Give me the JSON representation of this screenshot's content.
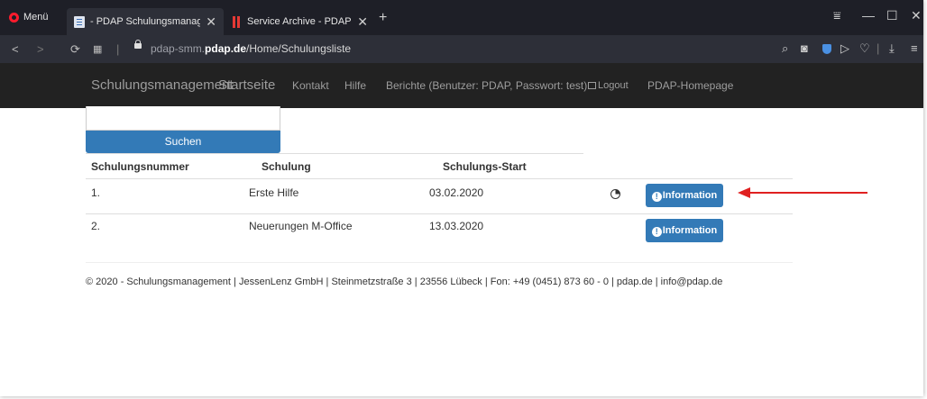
{
  "browser": {
    "menu_label": "Menü",
    "tabs": [
      {
        "title": "- PDAP Schulungsmanagem",
        "close": "✕"
      },
      {
        "title": "Service Archive - PDAP by J",
        "close": "✕"
      }
    ],
    "new_tab": "+",
    "window_controls": {
      "filter": "⩸",
      "minimize": "—",
      "maximize": "☐",
      "close": "✕"
    },
    "address": {
      "url_prefix": "pdap-smm.",
      "url_domain": "pdap.de",
      "url_path": "/Home/Schulungsliste"
    },
    "icons": [
      "back-icon",
      "forward-icon",
      "reload-icon",
      "speed-dial-icon",
      "lock-icon",
      "search-icon",
      "snapshot-icon",
      "shield-icon",
      "send-icon",
      "heart-icon",
      "download-icon",
      "easy-setup-icon"
    ],
    "accent_color": "#ff1b2d"
  },
  "navbar": {
    "brand": "Schulungsmanagement",
    "items": [
      "Startseite",
      "Kontakt",
      "Hilfe",
      "Berichte (Benutzer: PDAP, Passwort: test)",
      "Logout",
      "PDAP-Homepage"
    ]
  },
  "search": {
    "button_label": "Suchen",
    "value": ""
  },
  "table": {
    "headers": [
      "Schulungsnummer",
      "Schulung",
      "Schulungs-Start"
    ],
    "rows": [
      {
        "number": "1.",
        "name": "Erste Hilfe",
        "start": "03.02.2020",
        "has_clock": true,
        "button": "Information"
      },
      {
        "number": "2.",
        "name": "Neuerungen M-Office",
        "start": "13.03.2020",
        "has_clock": false,
        "button": "Information"
      }
    ]
  },
  "footer": {
    "text": "© 2020 - Schulungsmanagement | JessenLenz GmbH | Steinmetzstraße 3 | 23556 Lübeck | Fon: +49 (0451) 873 60 - 0 | pdap.de | info@pdap.de"
  },
  "colors": {
    "primary": "#337ab7",
    "navbar": "#222222",
    "annotation_arrow": "#e02020"
  }
}
